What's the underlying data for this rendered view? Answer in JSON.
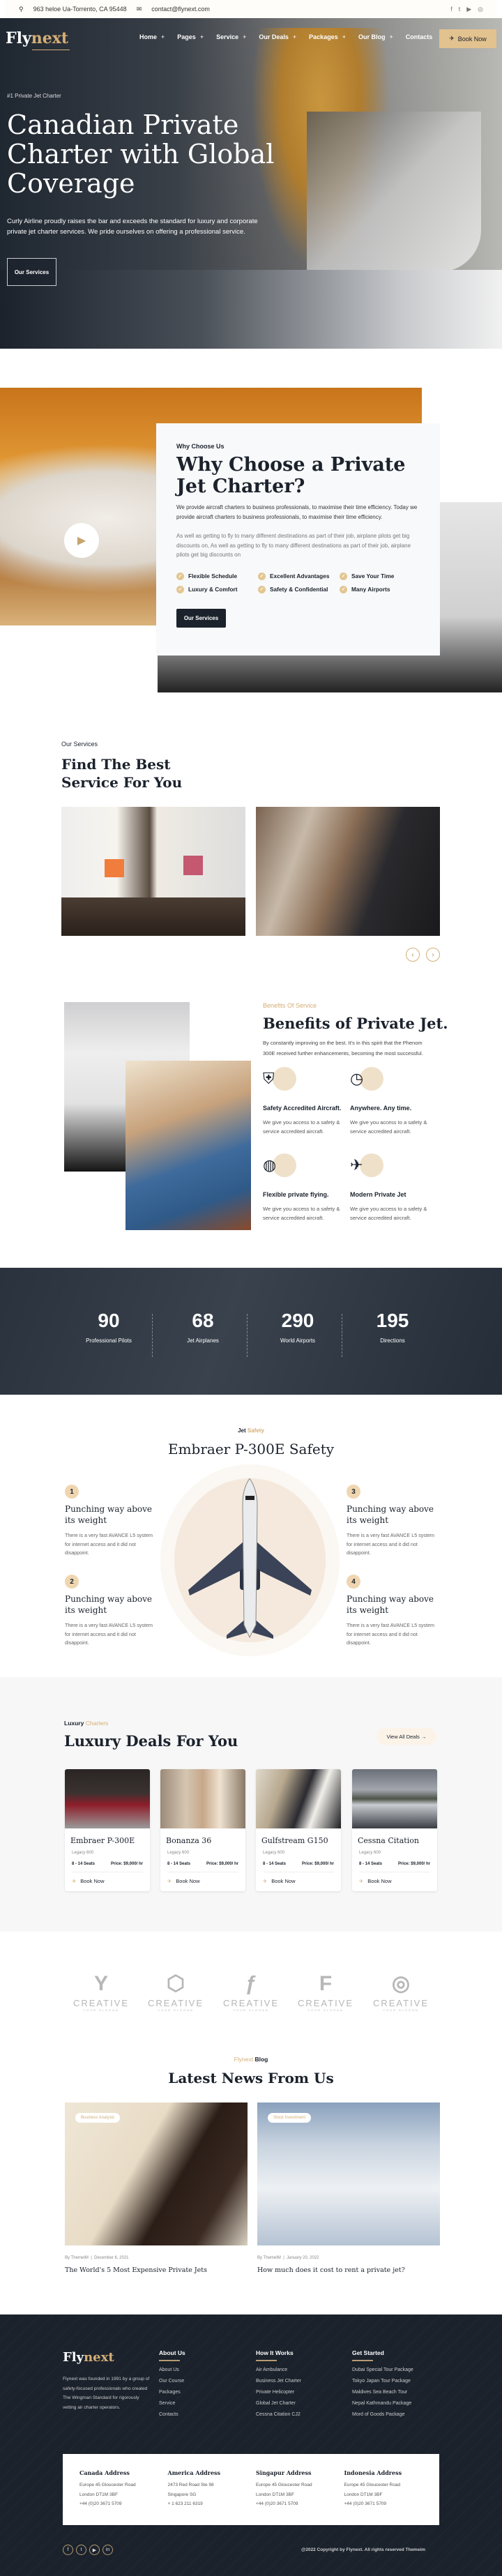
{
  "topbar": {
    "address": "963 heloe Ua-Torrento, CA 95448",
    "email": "contact@flynext.com",
    "social": [
      "facebook-icon",
      "twitter-icon",
      "youtube-icon",
      "instagram-icon"
    ]
  },
  "brand": {
    "logo_a": "Fly",
    "logo_b": "next",
    "accent": "#d4ae76",
    "dark": "#1b222c"
  },
  "nav": {
    "items": [
      "Home",
      "Pages",
      "Service",
      "Our Deals",
      "Packages",
      "Our Blog",
      "Contacts"
    ],
    "book_now": "Book Now"
  },
  "hero": {
    "tag": "#1 Private Jet Charter",
    "title": "Canadian Private Charter with Global Coverage",
    "text": "Curly Airline proudly raises the bar and exceeds the standard for luxury and corporate private jet charter services. We pride ourselves on offering a professional service.",
    "button": "Our Services"
  },
  "why": {
    "label": "Why Choose Us",
    "title": "Why Choose a Private Jet Charter?",
    "p1": "We provide aircraft charters to business professionals, to maximise their time efficiency. Today we provide aircraft charters to business professionals, to maximise their time efficiency.",
    "p2": "As well as getting to fly to many different destinations as part of their job, airplane pilots get big discounts on, As well as getting to fly to many different destinations as part of their job, airplane pilots get big discounts on",
    "features": [
      "Flexible Schedule",
      "Excellent Advantages",
      "Save Your Time",
      "Luxury & Comfort",
      "Safety & Confidential",
      "Many Airports"
    ],
    "button": "Our Services"
  },
  "services": {
    "label": "Our Services",
    "title": "Find The Best Service For You"
  },
  "benefits": {
    "label": "Benefits Of Service",
    "title": "Benefits of Private Jet.",
    "text": "By constantly improving on the best. It's in this spirit that the Phenom 300E received further enhancements, becoming the most successful.",
    "items": [
      {
        "title": "Safety Accredited Aircraft.",
        "desc": "We give you access to a safety & service accredited aircraft.",
        "icon": "shield-plane-icon"
      },
      {
        "title": "Anywhere. Any time.",
        "desc": "We give you access to a safety & service accredited aircraft.",
        "icon": "route-clock-icon"
      },
      {
        "title": "Flexible private flying.",
        "desc": "We give you access to a safety & service accredited aircraft.",
        "icon": "globe-plane-icon"
      },
      {
        "title": "Modern Private Jet",
        "desc": "We give you access to a safety & service accredited aircraft.",
        "icon": "airplane-icon"
      }
    ]
  },
  "stats": [
    {
      "value": "90",
      "label": "Professional Pilots"
    },
    {
      "value": "68",
      "label": "Jet Airplanes"
    },
    {
      "value": "290",
      "label": "World Airports"
    },
    {
      "value": "195",
      "label": "Directions"
    }
  ],
  "safety": {
    "label_a": "Jet",
    "label_b": "Safety",
    "title": "Embraer P-300E Safety",
    "items": [
      {
        "num": "1",
        "title": "Punching way above its weight",
        "desc": "There is a very fast AVANCE L5 system for internet access and it did not disappoint."
      },
      {
        "num": "2",
        "title": "Punching way above its weight",
        "desc": "There is a very fast AVANCE L5 system for internet access and it did not disappoint."
      },
      {
        "num": "3",
        "title": "Punching way above its weight",
        "desc": "There is a very fast AVANCE L5 system for internet access and it did not disappoint."
      },
      {
        "num": "4",
        "title": "Punching way above its weight",
        "desc": "There is a very fast AVANCE L5 system for internet access and it did not disappoint."
      }
    ]
  },
  "deals": {
    "label_a": "Luxury",
    "label_b": "Charters",
    "title": "Luxury Deals For You",
    "view_all": "View All Deals",
    "cards": [
      {
        "name": "Embraer P-300E",
        "sub": "Legacy 600",
        "seats": "8 - 14 Seats",
        "price": "Price: $9,000/ hr",
        "cta": "Book Now"
      },
      {
        "name": "Bonanza 36",
        "sub": "Legacy 600",
        "seats": "8 - 14 Seats",
        "price": "Price: $9,000/ hr",
        "cta": "Book Now"
      },
      {
        "name": "Gulfstream G150",
        "sub": "Legacy 600",
        "seats": "8 - 14 Seats",
        "price": "Price: $9,000/ hr",
        "cta": "Book Now"
      },
      {
        "name": "Cessna Citation",
        "sub": "Legacy 600",
        "seats": "8 - 14 Seats",
        "price": "Price: $9,000/ hr",
        "cta": "Book Now"
      }
    ]
  },
  "partners": [
    {
      "name": "CREATIVE",
      "slogan": "YOUR SLOGAN"
    },
    {
      "name": "CREATIVE",
      "slogan": "YOUR SLOGAN"
    },
    {
      "name": "CREATIVE",
      "slogan": "YOUR SLOGAN"
    },
    {
      "name": "CREATIVE",
      "slogan": "YOUR SLOGAN"
    },
    {
      "name": "CREATIVE",
      "slogan": "YOUR SLOGAN"
    }
  ],
  "blog": {
    "label_a": "Flynext",
    "label_b": "Blog",
    "title": "Latest News From Us",
    "posts": [
      {
        "tag": "Business Analysis",
        "author": "By ThemeIM",
        "date": "December 6, 2021",
        "title": "The World's 5 Most Expensive Private Jets"
      },
      {
        "tag": "Stock Investment",
        "author": "By ThemeIM",
        "date": "January 20, 2022",
        "title": "How much does it cost to rent a private jet?"
      }
    ]
  },
  "footer": {
    "about": "Flynext was founded in 1991 by a group of safety-focused professionals who created The Wingman Standard for rigorously vetting air charter operators.",
    "columns": [
      {
        "title": "About Us",
        "links": [
          "About Us",
          "Our Course",
          "Packages",
          "Service",
          "Contacts"
        ]
      },
      {
        "title": "How It Works",
        "links": [
          "Air Ambulance",
          "Business Jet Charter",
          "Private Helicopter",
          "Global Jet Charter",
          "Cessna Citation CJ2"
        ]
      },
      {
        "title": "Get Started",
        "links": [
          "Dubai Special Tour Package",
          "Tokyo Japan Tour Package",
          "Maldives Sea Beach Tour",
          "Nepal Kathmandu Package",
          "Mord of Goods Package"
        ]
      }
    ],
    "addresses": [
      {
        "title": "Canada Address",
        "l1": "Europe 45 Gloucester Road",
        "l2": "London DT1M 3BF",
        "l3": "+44 (0)20 3671 5709"
      },
      {
        "title": "America Address",
        "l1": "2473 Red Road Ste 98",
        "l2": "Singapore SG",
        "l3": "+ 1 623 211 6319"
      },
      {
        "title": "Singapur Address",
        "l1": "Europe 45 Gloucester Road",
        "l2": "London DT1M 3BF",
        "l3": "+44 (0)20 3671 5709"
      },
      {
        "title": "Indonesia Address",
        "l1": "Europe 45 Gloucester Road",
        "l2": "London DT1M 3BF",
        "l3": "+44 (0)20 3671 5709"
      }
    ],
    "copyright": "@2022 Copyright by Flynext. All rights reserved Themeim"
  }
}
